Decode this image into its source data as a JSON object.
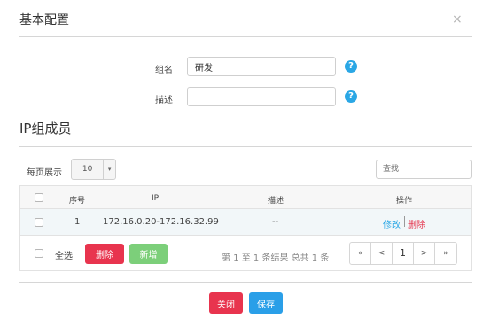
{
  "modal": {
    "title": "基本配置",
    "close_glyph": "×"
  },
  "form": {
    "name_label": "组名",
    "name_value": "研发",
    "desc_label": "描述",
    "desc_value": "",
    "help_glyph": "?"
  },
  "section": {
    "title": "IP组成员"
  },
  "toolbar": {
    "page_size_label": "每页展示",
    "page_size_value": "10",
    "caret_glyph": "▾",
    "search_placeholder": "查找"
  },
  "table": {
    "headers": {
      "index": "序号",
      "ip": "IP",
      "desc": "描述",
      "actions": "操作"
    },
    "rows": [
      {
        "index": "1",
        "ip": "172.16.0.20-172.16.32.99",
        "desc": "--",
        "edit": "修改",
        "delete": "删除"
      }
    ]
  },
  "footer": {
    "select_all_label": "全选",
    "delete_button": "删除",
    "add_button": "新增",
    "summary": "第 1 至 1 条结果  总共 1 条"
  },
  "pager": {
    "first": "«",
    "prev": "<",
    "current": "1",
    "next": ">",
    "last": "»"
  },
  "buttons": {
    "close": "关闭",
    "save": "保存"
  },
  "colors": {
    "primary": "#2a9fe8",
    "danger": "#e8344e",
    "success": "#7ccf7a",
    "help": "#2aa7e5"
  }
}
